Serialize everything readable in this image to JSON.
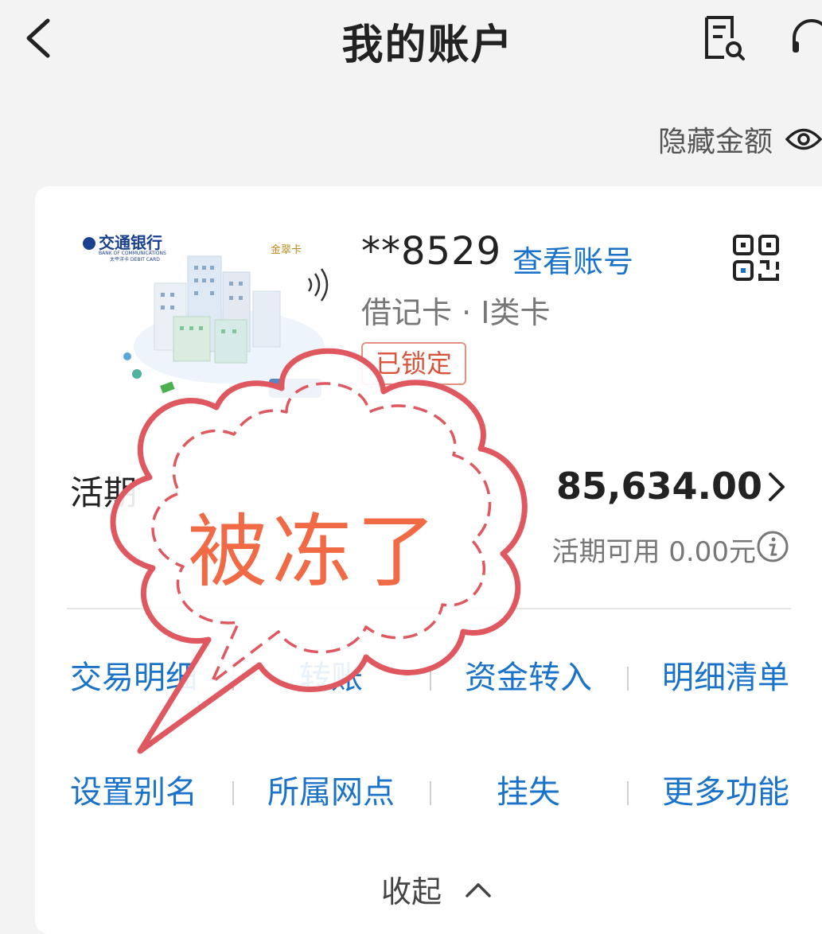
{
  "header": {
    "title": "我的账户"
  },
  "hide_amount": {
    "label": "隐藏金额"
  },
  "card": {
    "number": "**8529",
    "view_account_label": "查看账号",
    "type": "借记卡 · I类卡",
    "status_badge": "已锁定",
    "image_text": {
      "bank_name": "交通银行",
      "bank_name_en": "BANK OF COMMUNICATIONS",
      "card_series": "太平洋卡 DEBIT CARD",
      "tier": "金翠卡"
    }
  },
  "balance": {
    "label": "活期",
    "amount": "85,634.00",
    "available_text": "活期可用 0.00元"
  },
  "actions_row1": [
    "交易明细",
    "转账",
    "资金转入",
    "明细清单"
  ],
  "actions_row2": [
    "设置别名",
    "所属网点",
    "挂失",
    "更多功能"
  ],
  "collapse_label": "收起",
  "overlay": {
    "text": "被冻了"
  },
  "colors": {
    "link": "#1a73c9",
    "stamp": "#ef6a45",
    "stamp_outline": "#e0585f",
    "badge": "#d9533b"
  }
}
